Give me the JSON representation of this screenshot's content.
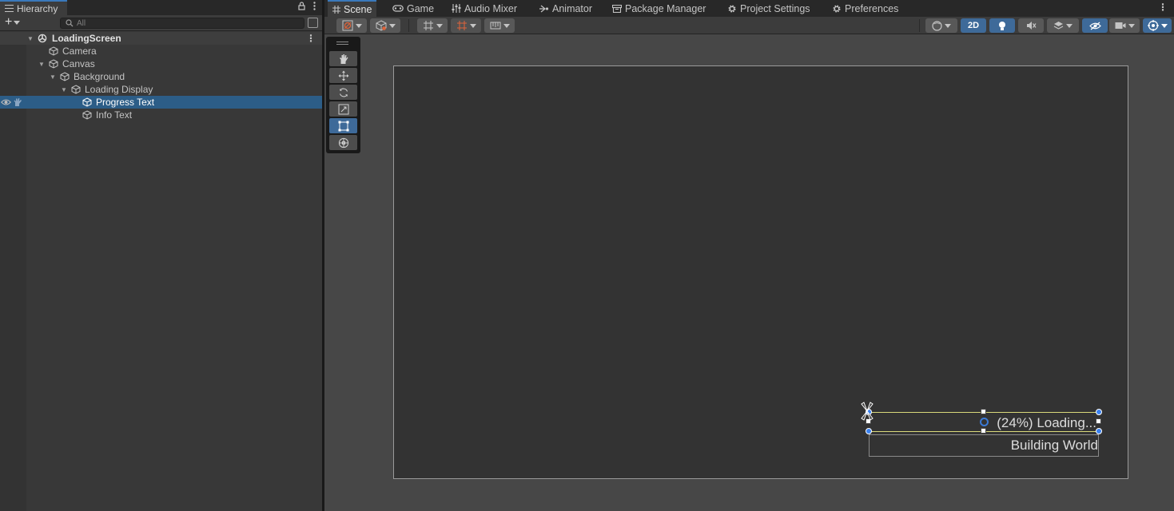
{
  "hierarchy": {
    "tab_title": "Hierarchy",
    "search_placeholder": "All",
    "rows": [
      {
        "label": "LoadingScreen",
        "kind": "scene"
      },
      {
        "label": "Camera"
      },
      {
        "label": "Canvas"
      },
      {
        "label": "Background"
      },
      {
        "label": "Loading Display"
      },
      {
        "label": "Progress Text",
        "selected": true
      },
      {
        "label": "Info Text"
      }
    ]
  },
  "scene_tabs": [
    {
      "label": "Scene",
      "icon": "grid-icon",
      "active": true
    },
    {
      "label": "Game",
      "icon": "gamepad-icon"
    },
    {
      "label": "Audio Mixer",
      "icon": "mixer-icon"
    },
    {
      "label": "Animator",
      "icon": "animator-icon"
    },
    {
      "label": "Package Manager",
      "icon": "package-icon"
    },
    {
      "label": "Project Settings",
      "icon": "gear-icon"
    },
    {
      "label": "Preferences",
      "icon": "gear-icon"
    }
  ],
  "toolbar": {
    "mode_2d_label": "2D"
  },
  "tools": [
    "hand-tool",
    "move-tool",
    "rotate-tool",
    "scale-tool",
    "rect-tool",
    "transform-tool"
  ],
  "active_tool": "rect-tool",
  "canvas": {
    "progress_text": "(24%) Loading...",
    "info_text": "Building World"
  },
  "colors": {
    "selection": "#2c5d87",
    "accent": "#3e6a99",
    "handle_blue": "#3b82f0",
    "rect_yellow": "#d9d97a"
  }
}
